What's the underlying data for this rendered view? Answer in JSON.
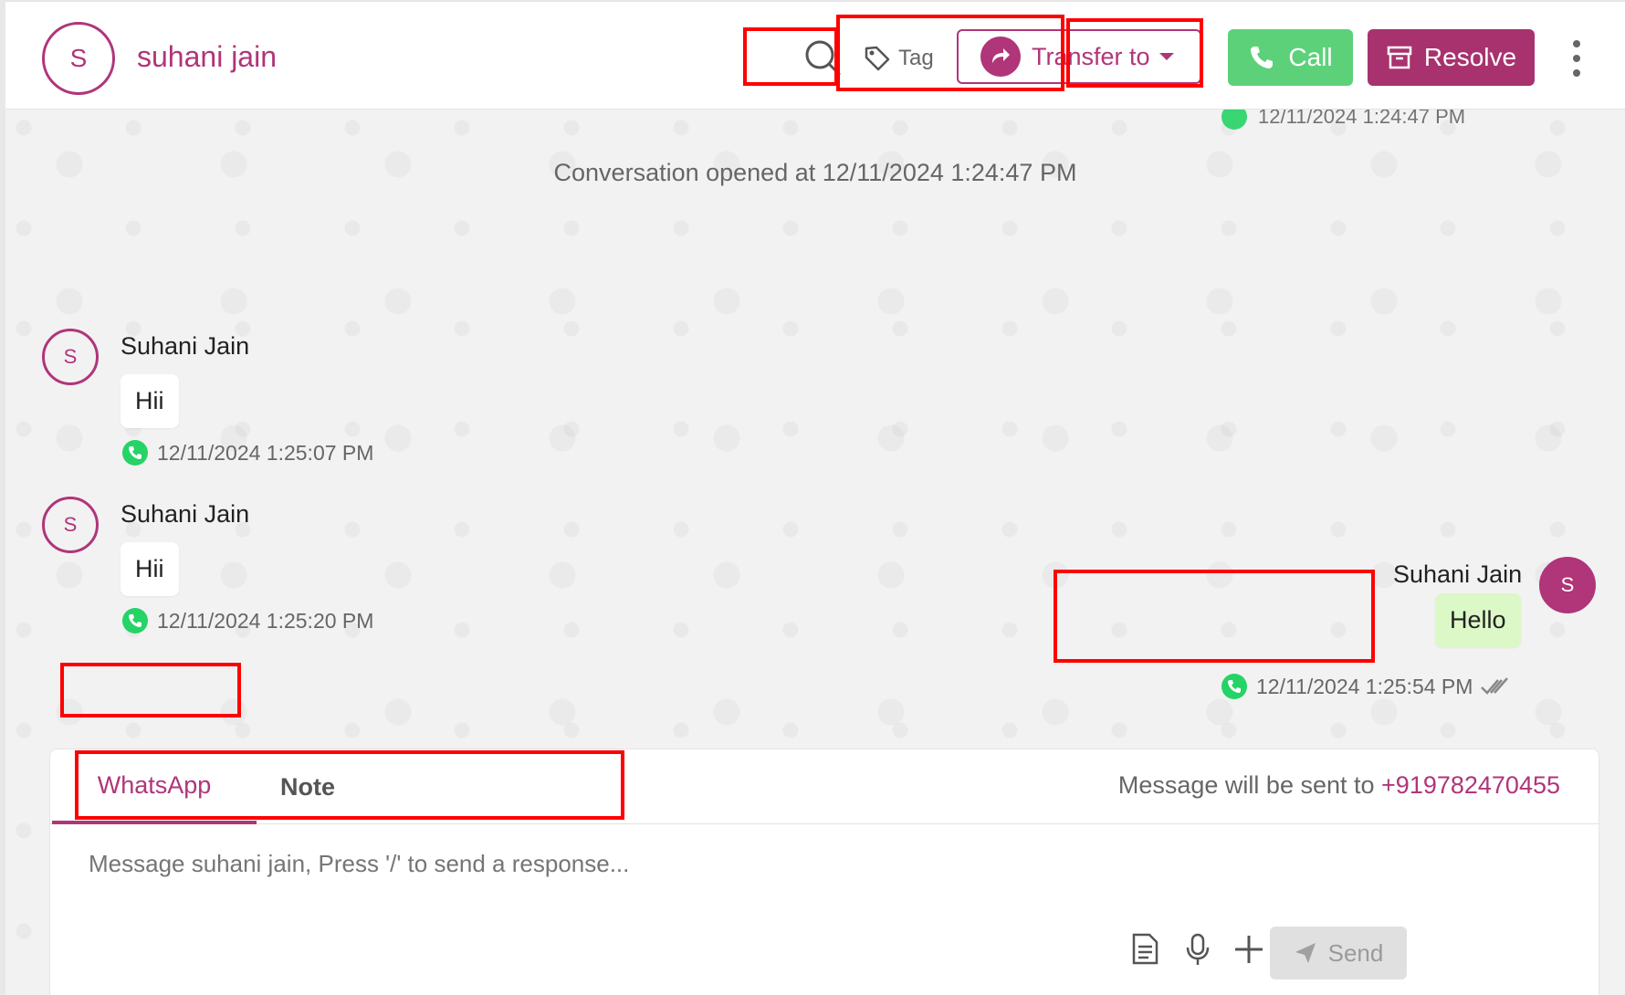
{
  "header": {
    "avatar_initial": "S",
    "contact_name": "suhani jain",
    "tag_label": "Tag",
    "transfer_label": "Transfer to",
    "call_label": "Call",
    "resolve_label": "Resolve"
  },
  "chat": {
    "partial_top_timestamp": "12/11/2024 1:24:47 PM",
    "system_message": "Conversation opened at 12/11/2024 1:24:47 PM",
    "messages": [
      {
        "avatar_initial": "S",
        "sender": "Suhani Jain",
        "text": "Hii",
        "timestamp": "12/11/2024 1:25:07 PM",
        "direction": "incoming"
      },
      {
        "avatar_initial": "S",
        "sender": "Suhani Jain",
        "text": "Hii",
        "timestamp": "12/11/2024 1:25:20 PM",
        "direction": "incoming"
      },
      {
        "avatar_initial": "S",
        "sender": "Suhani Jain",
        "text": "Hello",
        "timestamp": "12/11/2024 1:25:54 PM",
        "direction": "outgoing"
      }
    ]
  },
  "composer": {
    "tabs": [
      "WhatsApp",
      "Note"
    ],
    "active_tab": "WhatsApp",
    "sent_to_prefix": "Message will be sent to",
    "phone": "+919782470455",
    "placeholder": "Message suhani jain, Press '/' to send a response...",
    "send_label": "Send"
  },
  "colors": {
    "brand": "#b03579",
    "call_green": "#5dd17a",
    "whatsapp_green": "#25d366",
    "annotation_red": "#ff0000"
  },
  "icons": [
    "search-icon",
    "tag-icon",
    "transfer-icon",
    "phone-icon",
    "archive-icon",
    "kebab-icon",
    "whatsapp-icon",
    "double-check-icon",
    "template-icon",
    "mic-icon",
    "plus-icon",
    "send-icon"
  ]
}
